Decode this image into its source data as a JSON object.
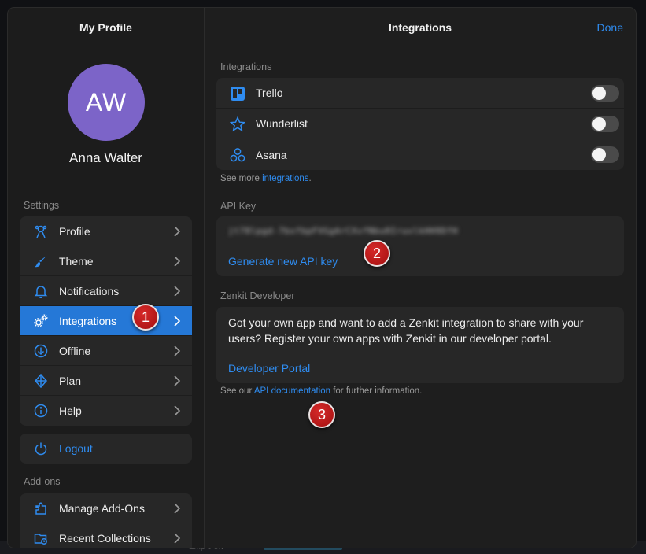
{
  "profile_panel": {
    "title": "My Profile",
    "avatar_initials": "AW",
    "avatar_color": "#7c64c8",
    "user_name": "Anna Walter",
    "settings_label": "Settings",
    "settings_items": [
      {
        "label": "Profile",
        "icon": "profile-icon"
      },
      {
        "label": "Theme",
        "icon": "brush-icon"
      },
      {
        "label": "Notifications",
        "icon": "bell-icon"
      },
      {
        "label": "Integrations",
        "icon": "gears-icon",
        "active": true
      },
      {
        "label": "Offline",
        "icon": "download-icon"
      },
      {
        "label": "Plan",
        "icon": "diamond-icon"
      },
      {
        "label": "Help",
        "icon": "info-icon"
      }
    ],
    "logout_label": "Logout",
    "addons_label": "Add-ons",
    "addon_items": [
      {
        "label": "Manage Add-Ons",
        "icon": "puzzle-icon"
      },
      {
        "label": "Recent Collections",
        "icon": "folder-clock-icon"
      }
    ]
  },
  "integrations_panel": {
    "title": "Integrations",
    "done_label": "Done",
    "integrations_label": "Integrations",
    "integrations": [
      {
        "name": "Trello",
        "icon": "trello-icon",
        "enabled": false
      },
      {
        "name": "Wunderlist",
        "icon": "star-icon",
        "enabled": false
      },
      {
        "name": "Asana",
        "icon": "asana-icon",
        "enabled": false
      }
    ],
    "see_more_prefix": "See more ",
    "see_more_link": "integrations",
    "see_more_suffix": ".",
    "api_key_label": "API Key",
    "api_key_value": "jt78lpgd-7bxfbpFVGgArCXvfNbu0IruvlkHH9DfH",
    "generate_label": "Generate new API key",
    "developer_label": "Zenkit Developer",
    "developer_text": "Got your own app and want to add a Zenkit integration to share with your users? Register your own apps with Zenkit in our developer portal.",
    "developer_portal_label": "Developer Portal",
    "docs_prefix": "See our ",
    "docs_link": "API documentation",
    "docs_suffix": " for further information."
  },
  "annotations": [
    "1",
    "2",
    "3"
  ],
  "background_strip": {
    "text": "Emp crew"
  },
  "colors": {
    "accent": "#2578d7",
    "link": "#2f8cf0",
    "badge": "#c31b1b"
  }
}
